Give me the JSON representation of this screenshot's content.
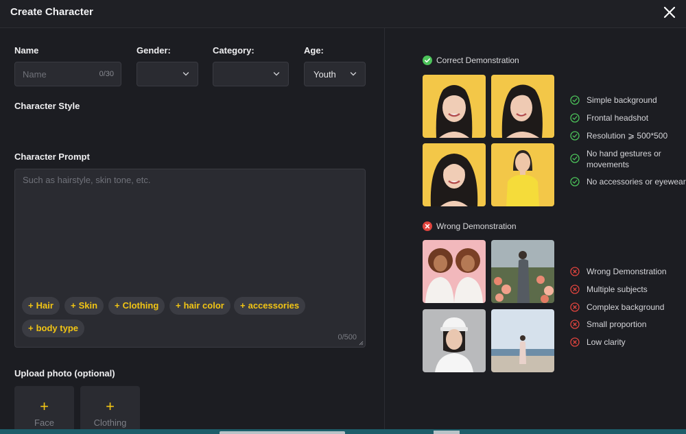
{
  "header": {
    "title": "Create Character"
  },
  "form": {
    "name_label": "Name",
    "name_placeholder": "Name",
    "name_counter": "0/30",
    "gender_label": "Gender:",
    "category_label": "Category:",
    "age_label": "Age:",
    "age_value": "Youth",
    "style_label": "Character Style",
    "prompt_label": "Character Prompt",
    "prompt_placeholder": "Such as hairstyle, skin tone, etc.",
    "prompt_counter": "0/500",
    "chips": [
      "Hair",
      "Skin",
      "Clothing",
      "hair color",
      "accessories",
      "body type"
    ],
    "upload_label": "Upload photo (optional)",
    "upload_face": "Face",
    "upload_clothing": "Clothing"
  },
  "demo": {
    "correct_title": "Correct Demonstration",
    "correct_items": [
      "Simple background",
      "Frontal headshot",
      "Resolution ⩾ 500*500",
      "No hand gestures or movements",
      "No accessories or eyewear"
    ],
    "wrong_title": "Wrong Demonstration",
    "wrong_items": [
      "Wrong Demonstration",
      "Multiple subjects",
      "Complex background",
      "Small proportion",
      "Low clarity"
    ]
  },
  "colors": {
    "accent": "#f2c514",
    "correct": "#4cc35a",
    "wrong": "#e0443e",
    "background": "#1c1d22"
  }
}
